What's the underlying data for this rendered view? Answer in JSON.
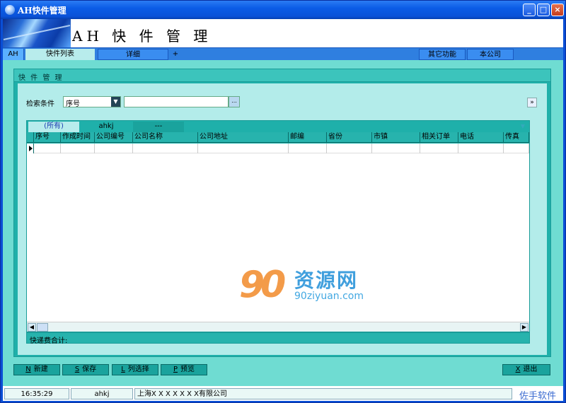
{
  "window": {
    "title": "AH快件管理"
  },
  "banner": {
    "title": "AH 快 件 管 理"
  },
  "tabs": {
    "ah": "AH",
    "list": "快件列表",
    "detail": "详细",
    "plus": "+",
    "other": "其它功能",
    "company": "本公司"
  },
  "panel": {
    "title": "快 件 管 理"
  },
  "search": {
    "label": "检索条件",
    "field": "序号",
    "value": "",
    "button": "..."
  },
  "grid": {
    "tabs": [
      "(所有)",
      "ahkj",
      "---"
    ],
    "columns": [
      "序号",
      "作成时间",
      "公司编号",
      "公司名称",
      "公司地址",
      "邮编",
      "省份",
      "市镇",
      "相关订单",
      "电话",
      "传真"
    ],
    "rows": [
      [
        "",
        "",
        "",
        "",
        "",
        "",
        "",
        "",
        "",
        "",
        ""
      ]
    ]
  },
  "total": {
    "label": "快递费合计:"
  },
  "watermark": {
    "logo": "90",
    "name": "资源网",
    "url": "90ziyuan.com"
  },
  "buttons": {
    "new": {
      "key": "N",
      "label": "新建"
    },
    "save": {
      "key": "S",
      "label": "保存"
    },
    "cols": {
      "key": "L",
      "label": "列选择"
    },
    "preview": {
      "key": "P",
      "label": "预览"
    },
    "exit": {
      "key": "X",
      "label": "退出"
    }
  },
  "status": {
    "time": "16:35:29",
    "user": "ahkj",
    "company": "上海X X X X X X X有限公司",
    "brand": "佐手软件"
  },
  "colors": {
    "titlebar": "#0b5ce6",
    "panel": "#1fb0aa",
    "background": "#6fdcd2"
  }
}
